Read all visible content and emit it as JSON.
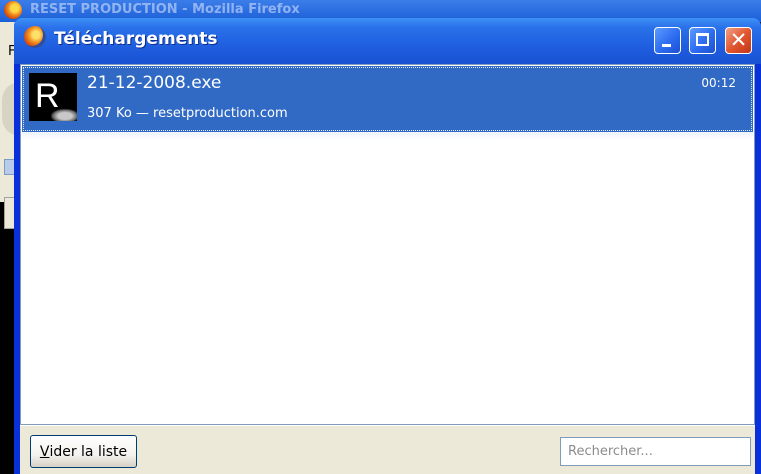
{
  "background_window": {
    "title": "RESET PRODUCTION - Mozilla Firefox",
    "menu_letter": "F"
  },
  "window": {
    "title": "Téléchargements",
    "close_glyph": "✕"
  },
  "downloads": [
    {
      "icon_letter": "R",
      "file_name": "21-12-2008.exe",
      "info": "307 Ko — resetproduction.com",
      "time": "00:12"
    }
  ],
  "bottom_bar": {
    "clear_label_accel": "V",
    "clear_label_rest": "ider la liste",
    "search_placeholder": "Rechercher..."
  },
  "colors": {
    "titlebar": "#1f5fe0",
    "selection": "#316ac5",
    "bottom_bar": "#ece9d8"
  }
}
